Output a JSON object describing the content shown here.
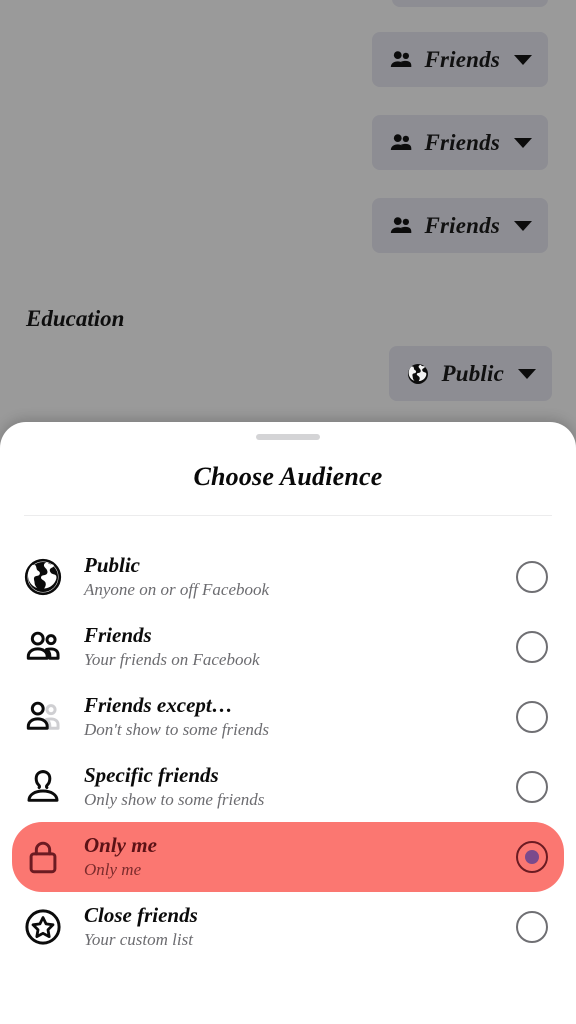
{
  "background": {
    "section_title": "Education",
    "chips": [
      {
        "label": "",
        "icon": "friends-icon",
        "partial": true
      },
      {
        "label": "Friends",
        "icon": "friends-icon",
        "partial": false
      },
      {
        "label": "Friends",
        "icon": "friends-icon",
        "partial": false
      },
      {
        "label": "Friends",
        "icon": "friends-icon",
        "partial": false
      },
      {
        "label": "Public",
        "icon": "globe-icon",
        "partial": false
      }
    ],
    "dim_color": "#9a9a9a",
    "chip_color": "#8d8d93"
  },
  "sheet": {
    "title": "Choose Audience",
    "grabber": "drag-handle",
    "background_color": "#ffffff",
    "selected_row_color": "#fb7771",
    "selected_dot_color": "#7a4a8c",
    "options": [
      {
        "id": "public",
        "icon": "globe-icon",
        "title": "Public",
        "subtitle": "Anyone on or off Facebook",
        "selected": false
      },
      {
        "id": "friends",
        "icon": "friends-icon",
        "title": "Friends",
        "subtitle": "Your friends on Facebook",
        "selected": false
      },
      {
        "id": "friends-except",
        "icon": "friends-except-icon",
        "title": "Friends except…",
        "subtitle": "Don't show to some friends",
        "selected": false
      },
      {
        "id": "specific-friends",
        "icon": "person-icon",
        "title": "Specific friends",
        "subtitle": "Only show to some friends",
        "selected": false
      },
      {
        "id": "only-me",
        "icon": "lock-icon",
        "title": "Only me",
        "subtitle": "Only me",
        "selected": true
      },
      {
        "id": "close-friends",
        "icon": "star-circle-icon",
        "title": "Close friends",
        "subtitle": "Your custom list",
        "selected": false
      }
    ]
  }
}
